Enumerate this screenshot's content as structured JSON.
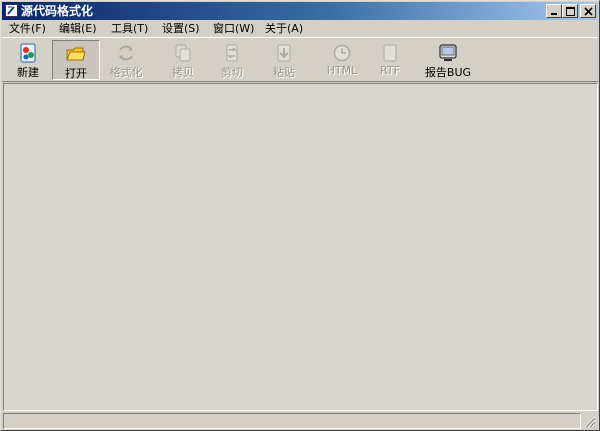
{
  "window": {
    "title": "源代码格式化"
  },
  "menu": [
    {
      "label": "文件(F)",
      "name": "menu-file"
    },
    {
      "label": "编辑(E)",
      "name": "menu-edit"
    },
    {
      "label": "工具(T)",
      "name": "menu-tools"
    },
    {
      "label": "设置(S)",
      "name": "menu-settings"
    },
    {
      "label": "窗口(W)",
      "name": "menu-window"
    },
    {
      "label": "关于(A)",
      "name": "menu-about"
    }
  ],
  "toolbar": {
    "new_label": "新建",
    "open_label": "打开",
    "format_label": "格式化",
    "copy_label": "拷贝",
    "cut_label": "剪切",
    "paste_label": "粘贴",
    "html_label": "HTML",
    "rtf_label": "RTF",
    "report_bug_label": "报告BUG"
  },
  "icons": {
    "app": "document-icon",
    "new": "new-file-icon",
    "open": "open-folder-icon",
    "format": "format-arrows-icon",
    "copy": "copy-icon",
    "cut": "cut-icon",
    "paste": "paste-icon",
    "html": "html-clock-icon",
    "rtf": "rtf-page-icon",
    "report_bug": "monitor-icon"
  },
  "colors": {
    "titlebar_start": "#0a246a",
    "titlebar_end": "#a6caf0",
    "face": "#d4d0c8"
  }
}
